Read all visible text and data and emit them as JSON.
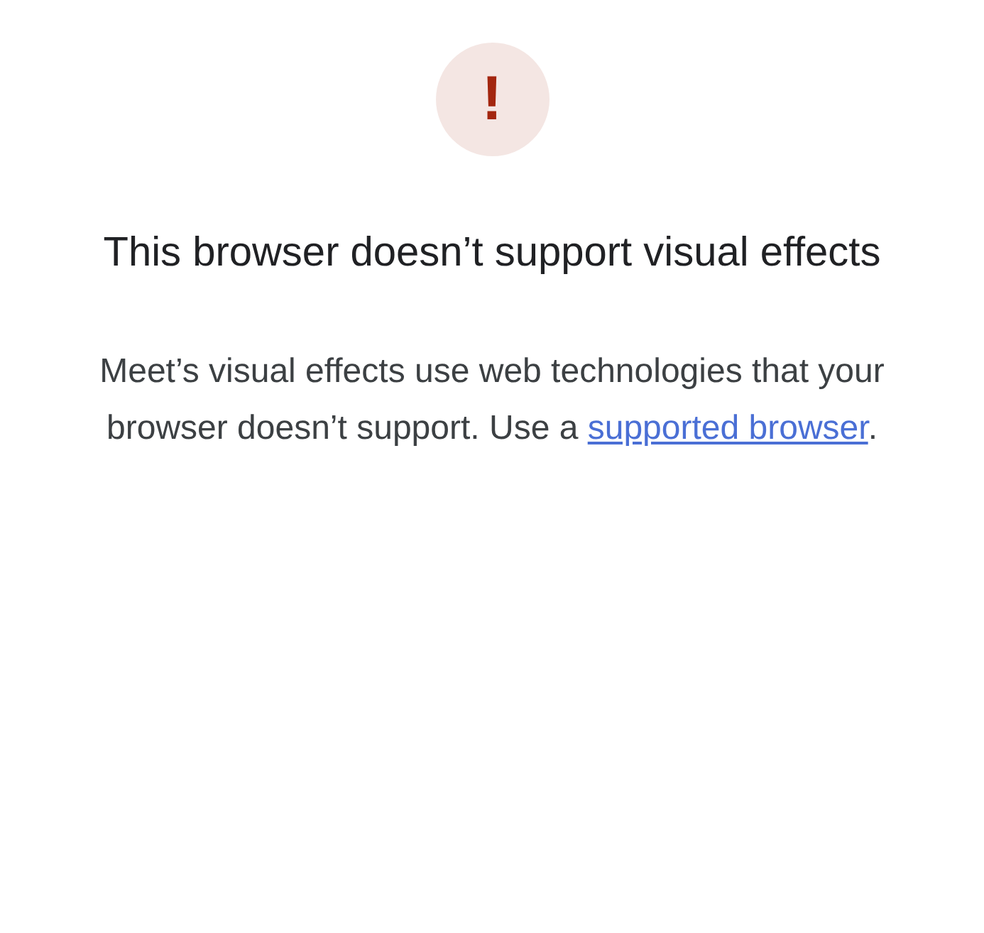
{
  "icon": {
    "glyph": "!"
  },
  "title": "This browser doesn’t support visual effects",
  "message": {
    "text": "Meet’s visual effects use web technologies that your browser doesn’t support. Use a ",
    "link": "supported browser",
    "end": "."
  }
}
